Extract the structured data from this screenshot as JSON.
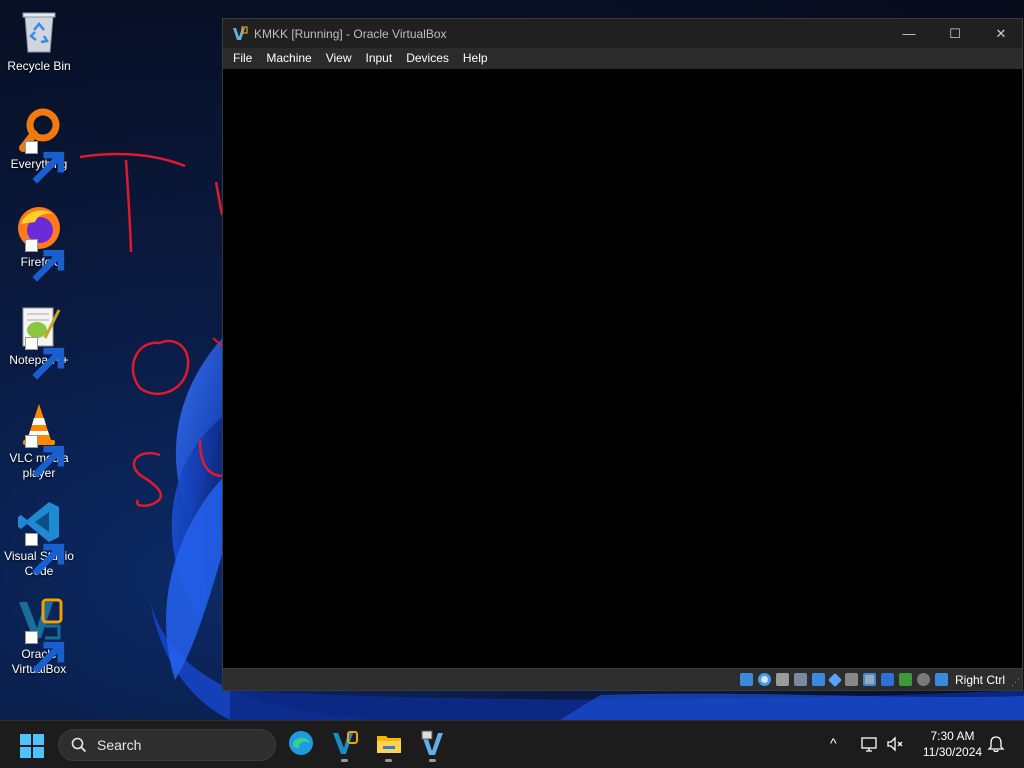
{
  "desktop": {
    "icons": [
      {
        "label": "Recycle Bin",
        "icon": "recycle-bin-icon"
      },
      {
        "label": "Everything",
        "icon": "everything-search-icon"
      },
      {
        "label": "Firefox",
        "icon": "firefox-icon"
      },
      {
        "label": "Notepad++",
        "icon": "notepad-plus-plus-icon"
      },
      {
        "label": "VLC media\nplayer",
        "icon": "vlc-cone-icon"
      },
      {
        "label": "Visual Studio\nCode",
        "icon": "vscode-icon"
      },
      {
        "label": "Oracle\nVirtualBox",
        "icon": "virtualbox-icon"
      }
    ],
    "handwriting": [
      "T",
      "O",
      "S"
    ],
    "colors": {
      "ink": "#e0192b",
      "bloom": "#1b54d8"
    }
  },
  "vbox_window": {
    "title": "KMKK [Running] - Oracle VirtualBox",
    "controls": {
      "minimize": "—",
      "maximize": "☐",
      "close": "✕"
    },
    "menu": [
      "File",
      "Machine",
      "View",
      "Input",
      "Devices",
      "Help"
    ],
    "status_icons": [
      "hard-disk-icon",
      "optical-drive-icon",
      "floppy-icon",
      "audio-icon",
      "network-icon",
      "usb-icon",
      "shared-folders-icon",
      "display-icon",
      "recording-icon",
      "cpu-icon",
      "mouse-integration-icon",
      "keyboard-icon"
    ],
    "host_key": "Right Ctrl"
  },
  "taskbar": {
    "search_placeholder": "Search",
    "apps": [
      "edge-icon",
      "virtualbox-icon",
      "file-explorer-icon",
      "vm-running-icon"
    ],
    "tray": {
      "chevron": "^",
      "time": "7:30 AM",
      "date": "11/30/2024"
    }
  }
}
